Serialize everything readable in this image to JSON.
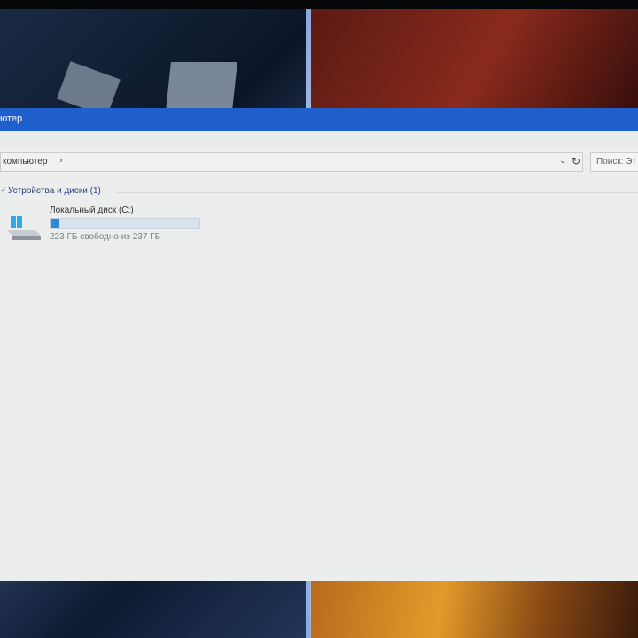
{
  "window": {
    "title": "ютер"
  },
  "address": {
    "path": "компьютер",
    "search_placeholder": "Поиск: Эт"
  },
  "group": {
    "label": "Устройства и диски (1)"
  },
  "drives": [
    {
      "name": "Локальный диск (C:)",
      "free_text": "223 ГБ свободно из 237 ГБ",
      "used_fraction": 0.06
    }
  ],
  "colors": {
    "titlebar": "#1f5fcc",
    "drive_bar_fill": "#2a8ad6",
    "group_label": "#2d3f7a"
  },
  "icons": {
    "breadcrumb_separator": "chevron-right-icon",
    "dropdown": "chevron-down-icon",
    "refresh": "refresh-icon",
    "group_toggle": "chevron-expand-icon",
    "drive": "windows-drive-icon"
  }
}
